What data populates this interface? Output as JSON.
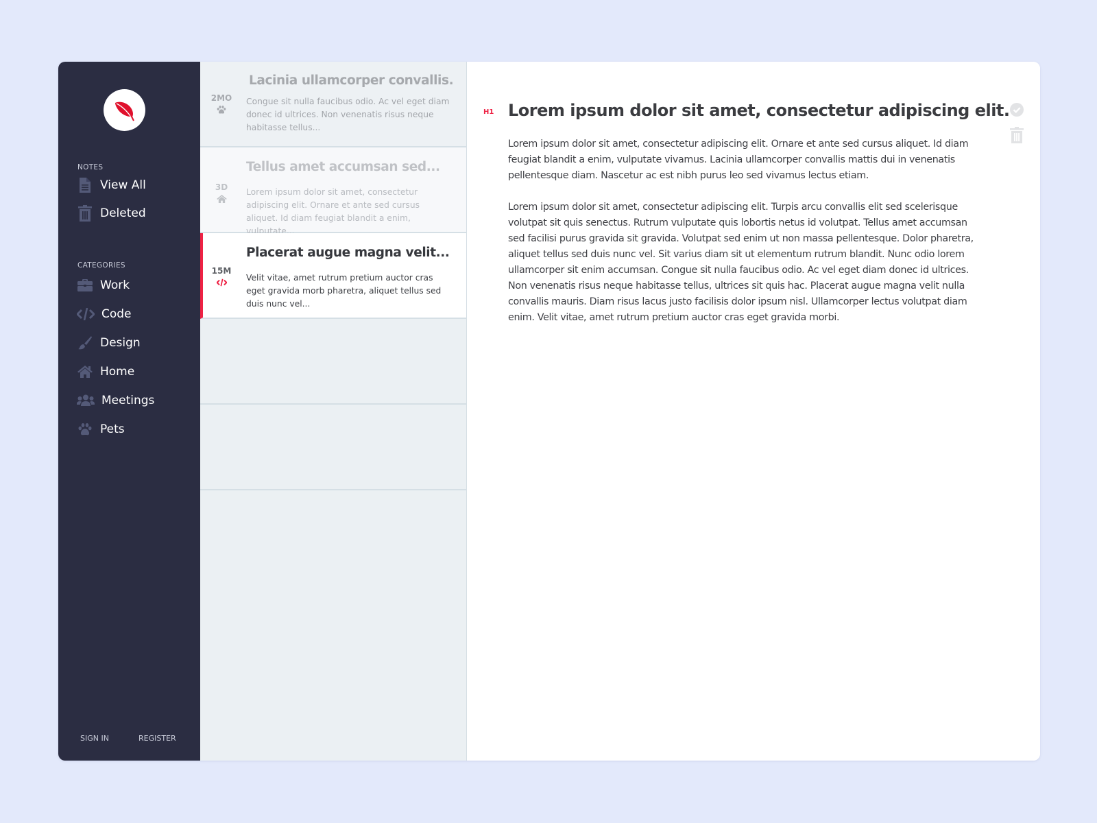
{
  "colors": {
    "accent": "#ee2244",
    "sidebar_bg": "#2b2d42",
    "page_bg": "#e3e9fb"
  },
  "sidebar": {
    "logo_icon": "feather-icon",
    "notes_label": "NOTES",
    "notes_items": [
      {
        "label": "View All",
        "icon": "document-icon"
      },
      {
        "label": "Deleted",
        "icon": "trash-icon"
      }
    ],
    "categories_label": "CATEGORIES",
    "categories": [
      {
        "label": "Work",
        "icon": "briefcase-icon"
      },
      {
        "label": "Code",
        "icon": "code-icon"
      },
      {
        "label": "Design",
        "icon": "paintbrush-icon"
      },
      {
        "label": "Home",
        "icon": "home-icon"
      },
      {
        "label": "Meetings",
        "icon": "users-icon"
      },
      {
        "label": "Pets",
        "icon": "paw-icon"
      }
    ],
    "sign_in": "SIGN IN",
    "register": "REGISTER"
  },
  "notes": [
    {
      "age": "2MO",
      "category_icon": "paw-icon",
      "title": "Lacinia ullamcorper convallis...",
      "excerpt": "Congue sit nulla faucibus odio. Ac vel eget diam donec id ultrices. Non venenatis risus neque habitasse tellus..."
    },
    {
      "age": "3D",
      "category_icon": "home-icon",
      "title": "Tellus amet accumsan sed...",
      "excerpt": "Lorem ipsum dolor sit amet, consectetur adipiscing elit. Ornare et ante sed cursus aliquet. Id diam feugiat blandit a enim, vulputate..."
    },
    {
      "age": "15M",
      "category_icon": "code-icon",
      "title": "Placerat augue magna velit...",
      "excerpt": "Velit vitae, amet rutrum pretium auctor cras eget gravida morb pharetra, aliquet tellus sed duis nunc vel...",
      "selected": true
    }
  ],
  "editor": {
    "heading_tag": "H1",
    "title": "Lorem ipsum dolor sit amet, consectetur adipiscing elit.",
    "paragraphs": [
      "Lorem ipsum dolor sit amet, consectetur adipiscing elit. Ornare et ante sed cursus aliquet. Id diam feugiat blandit a enim, vulputate vivamus. Lacinia ullamcorper convallis mattis dui in venenatis pellentesque diam. Nascetur ac est nibh purus leo sed vivamus lectus etiam.",
      "Lorem ipsum dolor sit amet, consectetur adipiscing elit. Turpis arcu convallis elit sed scelerisque volutpat sit quis senectus. Rutrum vulputate quis lobortis netus id volutpat. Tellus amet accumsan sed facilisi purus gravida sit gravida. Volutpat sed enim ut non massa pellentesque. Dolor pharetra, aliquet tellus sed duis nunc vel. Sit varius diam sit ut elementum rutrum blandit. Nunc odio lorem ullamcorper sit enim accumsan. Congue sit nulla faucibus odio. Ac vel eget diam donec id ultrices. Non venenatis risus neque habitasse tellus, ultrices sit quis hac. Placerat augue magna velit nulla convallis mauris. Diam risus lacus justo facilisis dolor ipsum nisl. Ullamcorper lectus volutpat diam enim. Velit vitae, amet rutrum pretium auctor cras eget gravida morbi."
    ],
    "tools": [
      {
        "icon": "check-circle-icon"
      },
      {
        "icon": "trash-icon"
      }
    ]
  }
}
